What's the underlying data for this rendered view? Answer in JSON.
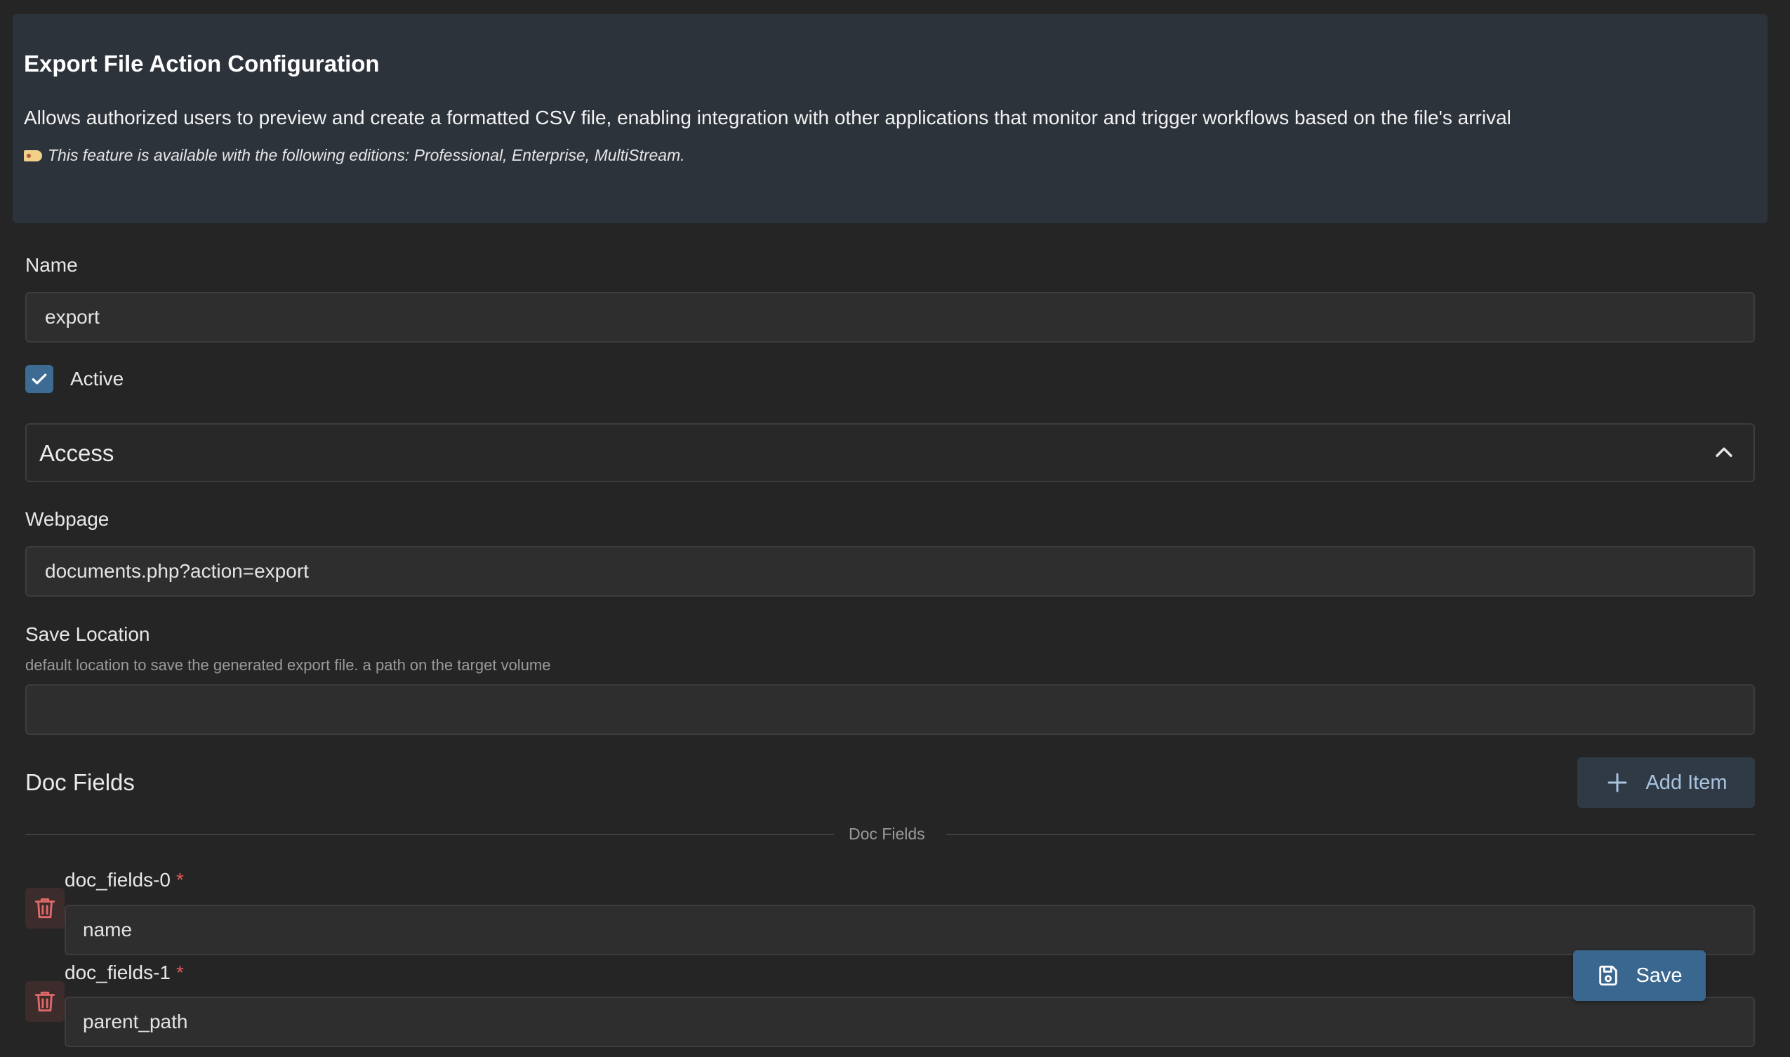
{
  "banner": {
    "title": "Export File Action Configuration",
    "description": "Allows authorized users to preview and create a formatted CSV file, enabling integration with other applications that monitor and trigger workflows based on the file's arrival",
    "editions_note": "This feature is available with the following editions: Professional, Enterprise, MultiStream.",
    "note_icon": "tag-icon"
  },
  "name_field": {
    "label": "Name",
    "value": "export"
  },
  "active_checkbox": {
    "label": "Active",
    "checked": true
  },
  "access_section": {
    "title": "Access",
    "expanded": true
  },
  "webpage_field": {
    "label": "Webpage",
    "value": "documents.php?action=export"
  },
  "save_location_field": {
    "label": "Save Location",
    "help": "default location to save the generated export file. a path on the target volume",
    "value": ""
  },
  "doc_fields": {
    "title": "Doc Fields",
    "add_label": "Add Item",
    "divider_label": "Doc Fields",
    "items": [
      {
        "label": "doc_fields-0",
        "required_mark": "*",
        "value": "name"
      },
      {
        "label": "doc_fields-1",
        "required_mark": "*",
        "value": "parent_path"
      }
    ]
  },
  "save_button": {
    "label": "Save"
  },
  "colors": {
    "background": "#252525",
    "banner": "#2d333b",
    "accent": "#3a6790",
    "danger": "#e05a5a"
  }
}
